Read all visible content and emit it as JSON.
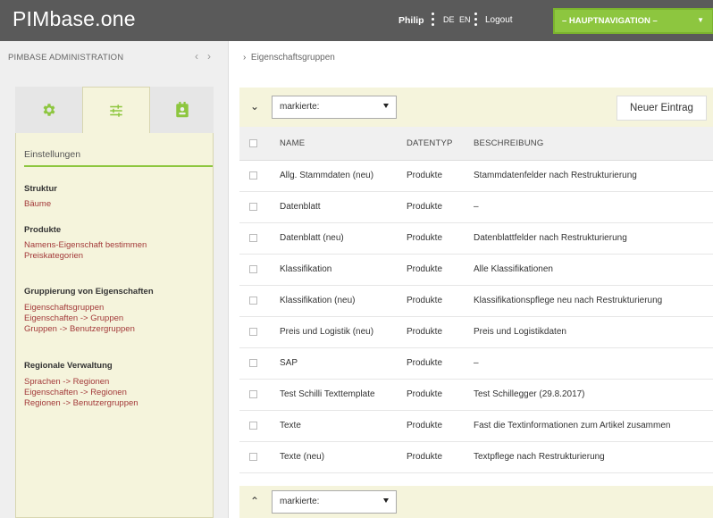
{
  "header": {
    "logo": "PIMbase.one",
    "user": "Philip",
    "lang_de": "DE",
    "lang_en": "EN",
    "logout": "Logout",
    "main_nav": "– HAUPTNAVIGATION –",
    "accent_color": "#8dc63f"
  },
  "sidebar": {
    "title": "PIMBASE ADMINISTRATION",
    "tabs": [
      {
        "icon": "gear-icon",
        "active": false
      },
      {
        "icon": "sliders-icon",
        "active": true
      },
      {
        "icon": "user-badge-icon",
        "active": false
      }
    ],
    "panel_heading": "Einstellungen",
    "sections": [
      {
        "title": "Struktur",
        "links": [
          "Bäume"
        ]
      },
      {
        "title": "Produkte",
        "links": [
          "Namens-Eigenschaft bestimmen",
          "Preiskategorien"
        ]
      },
      {
        "title": "Gruppierung von Eigenschaften",
        "links": [
          "Eigenschaftsgruppen",
          "Eigenschaften -> Gruppen",
          "Gruppen -> Benutzergruppen"
        ]
      },
      {
        "title": "Regionale Verwaltung",
        "links": [
          "Sprachen -> Regionen",
          "Eigenschaften -> Regionen",
          "Regionen -> Benutzergruppen"
        ]
      }
    ]
  },
  "breadcrumb": "Eigenschaftsgruppen",
  "toolbar": {
    "select_value": "markierte:",
    "new_entry": "Neuer Eintrag"
  },
  "bottombar": {
    "select_value": "markierte:"
  },
  "table": {
    "headers": [
      "NAME",
      "DATENTYP",
      "BESCHREIBUNG"
    ],
    "rows": [
      [
        "Allg. Stammdaten (neu)",
        "Produkte",
        "Stammdatenfelder nach Restrukturierung"
      ],
      [
        "Datenblatt",
        "Produkte",
        "–"
      ],
      [
        "Datenblatt (neu)",
        "Produkte",
        "Datenblattfelder nach Restrukturierung"
      ],
      [
        "Klassifikation",
        "Produkte",
        "Alle Klassifikationen"
      ],
      [
        "Klassifikation (neu)",
        "Produkte",
        "Klassifikationspflege neu nach Restrukturierung"
      ],
      [
        "Preis und Logistik (neu)",
        "Produkte",
        "Preis und Logistikdaten"
      ],
      [
        "SAP",
        "Produkte",
        "–"
      ],
      [
        "Test Schilli Texttemplate",
        "Produkte",
        "Test Schillegger (29.8.2017)"
      ],
      [
        "Texte",
        "Produkte",
        "Fast die Textinformationen zum Artikel zusammen"
      ],
      [
        "Texte (neu)",
        "Produkte",
        "Textpflege nach Restrukturierung"
      ]
    ]
  }
}
